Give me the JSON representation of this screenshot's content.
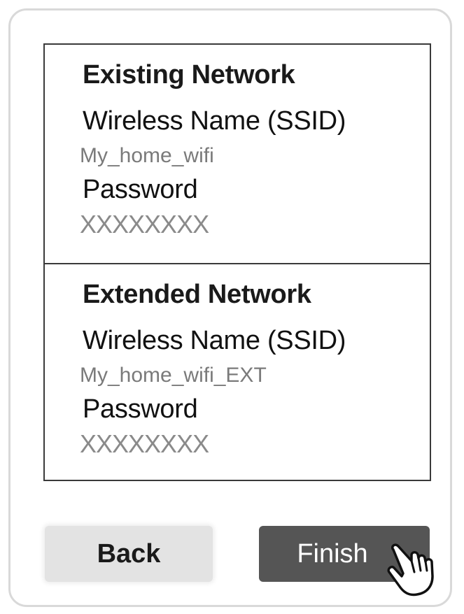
{
  "existing_network": {
    "heading": "Existing Network",
    "ssid_label": "Wireless Name (SSID)",
    "ssid_value": "My_home_wifi",
    "password_label": "Password",
    "password_value": "XXXXXXXX"
  },
  "extended_network": {
    "heading": "Extended Network",
    "ssid_label": "Wireless Name (SSID)",
    "ssid_value": "My_home_wifi_EXT",
    "password_label": "Password",
    "password_value": "XXXXXXXX"
  },
  "buttons": {
    "back_label": "Back",
    "finish_label": "Finish"
  },
  "icons": {
    "cursor": "hand-pointer-icon"
  },
  "colors": {
    "finish_button": "#555555",
    "back_button": "#e3e3e3",
    "value_text": "#7a7a7a"
  }
}
